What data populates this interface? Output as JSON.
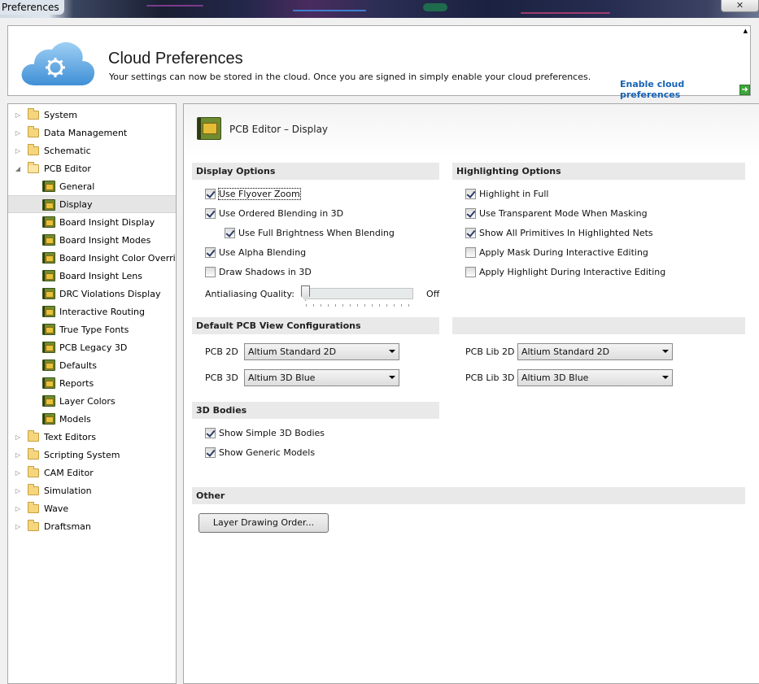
{
  "window": {
    "title": "Preferences",
    "close_label": "✕"
  },
  "banner": {
    "title": "Cloud Preferences",
    "subtitle": "Your settings can now be stored in the cloud. Once you are signed in simply enable your cloud preferences.",
    "enable_link": "Enable cloud preferences"
  },
  "tree": [
    {
      "label": "System",
      "kind": "folder",
      "level": 0,
      "expanded": false
    },
    {
      "label": "Data Management",
      "kind": "folder",
      "level": 0,
      "expanded": false
    },
    {
      "label": "Schematic",
      "kind": "folder",
      "level": 0,
      "expanded": false
    },
    {
      "label": "PCB Editor",
      "kind": "folder",
      "level": 0,
      "expanded": true
    },
    {
      "label": "General",
      "kind": "pcb",
      "level": 1
    },
    {
      "label": "Display",
      "kind": "pcb",
      "level": 1,
      "selected": true
    },
    {
      "label": "Board Insight Display",
      "kind": "pcb",
      "level": 1
    },
    {
      "label": "Board Insight Modes",
      "kind": "pcb",
      "level": 1
    },
    {
      "label": "Board Insight Color Overrid",
      "kind": "pcb",
      "level": 1
    },
    {
      "label": "Board Insight Lens",
      "kind": "pcb",
      "level": 1
    },
    {
      "label": "DRC Violations Display",
      "kind": "pcb",
      "level": 1
    },
    {
      "label": "Interactive Routing",
      "kind": "pcb",
      "level": 1
    },
    {
      "label": "True Type Fonts",
      "kind": "pcb",
      "level": 1
    },
    {
      "label": "PCB Legacy 3D",
      "kind": "pcb",
      "level": 1
    },
    {
      "label": "Defaults",
      "kind": "pcb",
      "level": 1
    },
    {
      "label": "Reports",
      "kind": "pcb",
      "level": 1
    },
    {
      "label": "Layer Colors",
      "kind": "pcb",
      "level": 1
    },
    {
      "label": "Models",
      "kind": "pcb",
      "level": 1
    },
    {
      "label": "Text Editors",
      "kind": "folder",
      "level": 0,
      "expanded": false
    },
    {
      "label": "Scripting System",
      "kind": "folder",
      "level": 0,
      "expanded": false
    },
    {
      "label": "CAM Editor",
      "kind": "folder",
      "level": 0,
      "expanded": false
    },
    {
      "label": "Simulation",
      "kind": "folder",
      "level": 0,
      "expanded": false
    },
    {
      "label": "Wave",
      "kind": "folder",
      "level": 0,
      "expanded": false
    },
    {
      "label": "Draftsman",
      "kind": "folder",
      "level": 0,
      "expanded": false
    }
  ],
  "panel": {
    "title": "PCB Editor – Display",
    "display_options": {
      "heading": "Display Options",
      "flyover_zoom": {
        "label": "Use Flyover Zoom",
        "checked": true
      },
      "ordered_blending": {
        "label": "Use Ordered Blending in 3D",
        "checked": true
      },
      "full_brightness": {
        "label": "Use Full Brightness When Blending",
        "checked": true
      },
      "alpha_blending": {
        "label": "Use Alpha Blending",
        "checked": true
      },
      "draw_shadows": {
        "label": "Draw Shadows in 3D",
        "checked": false
      },
      "antialiasing_label": "Antialiasing Quality:",
      "antialiasing_value": "Off",
      "antialiasing_level": 0
    },
    "highlighting_options": {
      "heading": "Highlighting Options",
      "highlight_full": {
        "label": "Highlight in Full",
        "checked": true
      },
      "transparent_mode": {
        "label": "Use Transparent Mode When Masking",
        "checked": true
      },
      "show_primitives": {
        "label": "Show All Primitives In Highlighted Nets",
        "checked": true
      },
      "apply_mask": {
        "label": "Apply Mask During Interactive Editing",
        "checked": false
      },
      "apply_highlight": {
        "label": "Apply Highlight During Interactive Editing",
        "checked": false
      }
    },
    "view_configs": {
      "heading": "Default PCB View Configurations",
      "pcb2d_label": "PCB 2D",
      "pcb2d_value": "Altium Standard 2D",
      "pcb3d_label": "PCB 3D",
      "pcb3d_value": "Altium 3D Blue",
      "lib2d_label": "PCB Lib 2D",
      "lib2d_value": "Altium Standard 2D",
      "lib3d_label": "PCB Lib 3D",
      "lib3d_value": "Altium 3D Blue"
    },
    "bodies": {
      "heading": "3D Bodies",
      "simple": {
        "label": "Show Simple 3D Bodies",
        "checked": true
      },
      "generic": {
        "label": "Show Generic Models",
        "checked": true
      }
    },
    "other": {
      "heading": "Other",
      "layer_order_button": "Layer Drawing Order..."
    }
  }
}
